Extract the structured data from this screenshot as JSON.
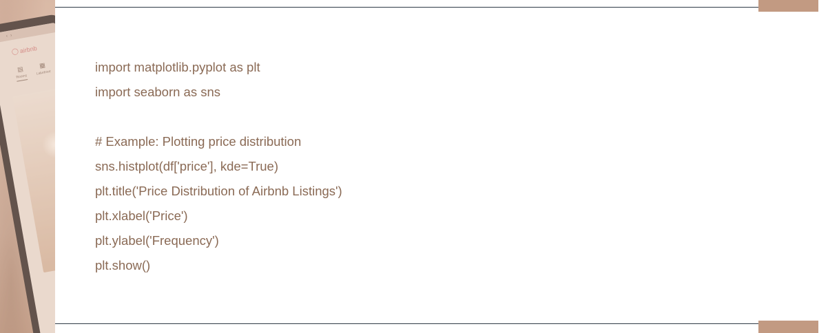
{
  "code": {
    "lines": [
      "import matplotlib.pyplot as plt",
      "import seaborn as sns",
      "",
      "# Example: Plotting price distribution",
      "sns.histplot(df['price'], kde=True)",
      "plt.title('Price Distribution of Airbnb Listings')",
      "plt.xlabel('Price')",
      "plt.ylabel('Frequency')",
      "plt.show()"
    ]
  },
  "photo": {
    "logo_text": "airbnb",
    "tab_labels": [
      "Rooms",
      "Lakefront"
    ]
  },
  "colors": {
    "code_text": "#8a6a55",
    "accent": "#c29a82",
    "rule": "#2e3a45",
    "background": "#ffffff"
  },
  "icons": [
    "airbnb-logo-icon",
    "back-arrow-icon",
    "rooms-icon",
    "lakefront-icon"
  ]
}
